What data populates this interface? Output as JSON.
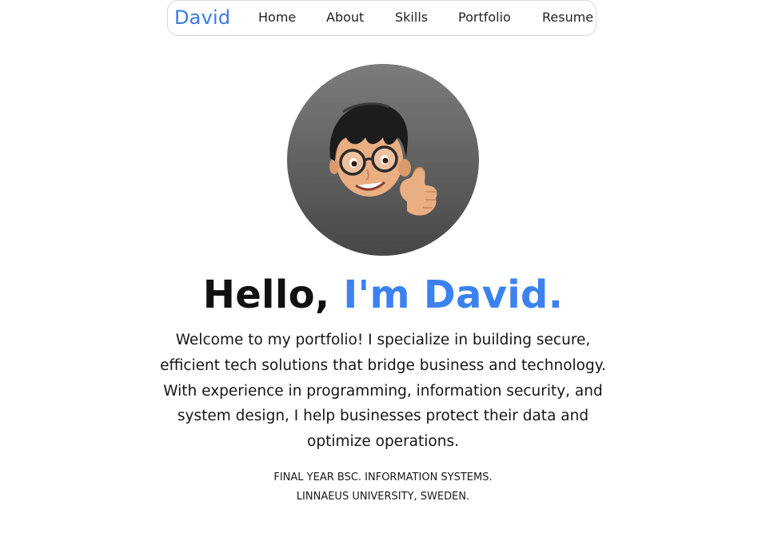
{
  "nav": {
    "brand": "David",
    "items": [
      {
        "label": "Home"
      },
      {
        "label": "About"
      },
      {
        "label": "Skills"
      },
      {
        "label": "Portfolio"
      },
      {
        "label": "Resume"
      }
    ]
  },
  "hero": {
    "greeting": "Hello, ",
    "name": "I'm David.",
    "intro": "Welcome to my portfolio! I specialize in building secure, efficient tech solutions that bridge business and technology. With experience in programming, information security, and system design, I help businesses protect their data and optimize operations.",
    "degree_line1": "Final Year BSc. Information Systems.",
    "degree_line2": "Linnaeus University, Sweden."
  },
  "avatar": {
    "icon": "memoji-thumbs-up-avatar"
  },
  "colors": {
    "accent": "#3b82f0",
    "brand": "#3b7be0",
    "text": "#111111"
  }
}
